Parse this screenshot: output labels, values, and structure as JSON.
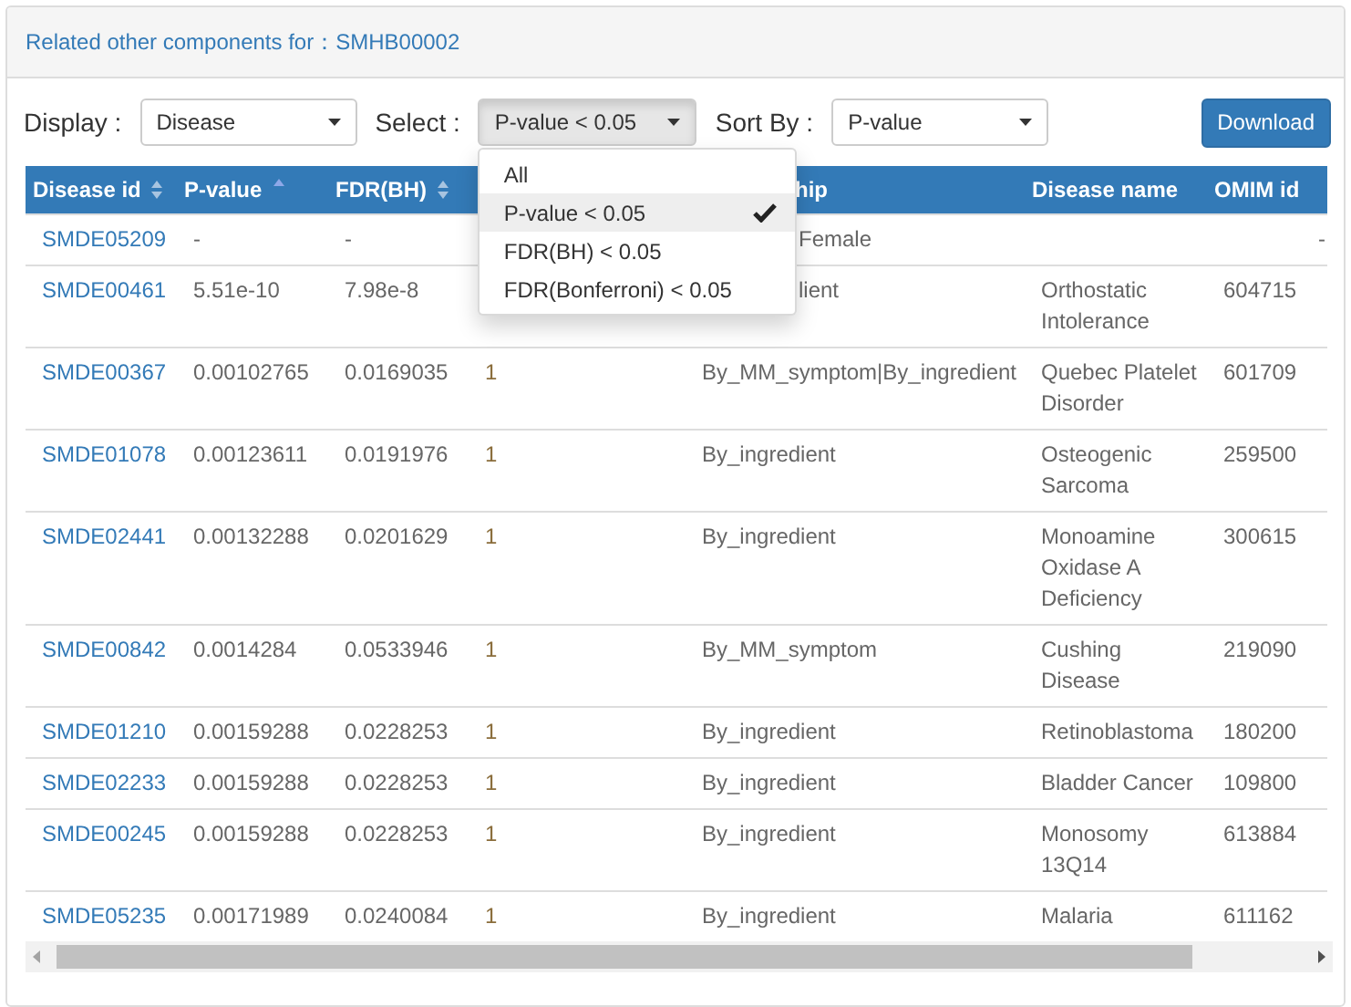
{
  "panel_heading": {
    "label": "Related other components for：",
    "value": "SMHB00002"
  },
  "filters": [
    {
      "kind": "select",
      "label": "Display :",
      "value": "Disease",
      "expanded": false
    },
    {
      "kind": "select",
      "label": "Select :",
      "value": "P-value < 0.05",
      "expanded": true,
      "options": [
        {
          "label": "All",
          "selected": false
        },
        {
          "label": "P-value < 0.05",
          "selected": true
        },
        {
          "label": "FDR(BH) < 0.05",
          "selected": false
        },
        {
          "label": "FDR(Bonferroni) < 0.05",
          "selected": false
        }
      ]
    },
    {
      "kind": "select",
      "label": "Sort By :",
      "value": "P-value",
      "expanded": false
    }
  ],
  "download_button": "Download",
  "table": {
    "columns": [
      {
        "label": "Disease id",
        "sortable": true,
        "sorted": false
      },
      {
        "label": "P-value",
        "sortable": true,
        "sorted": true
      },
      {
        "label": "FDR(BH)",
        "sortable": true,
        "sorted": false
      },
      {},
      {
        "label": "hip"
      },
      {
        "label": "Disease name"
      },
      {
        "label": "OMIM id"
      },
      {}
    ],
    "rows": [
      {
        "cells": [
          "SMDE05209",
          "-",
          "-",
          "",
          "Female",
          "",
          "",
          "-"
        ]
      },
      {
        "cells": [
          "SMDE00461",
          "5.51e-10",
          "7.98e-8",
          "",
          "lient",
          "Orthostatic Intolerance",
          "604715",
          ""
        ]
      },
      {
        "cells": [
          "SMDE00367",
          "0.00102765",
          "0.0169035",
          "1",
          "By_MM_symptom|By_ingredient",
          "Quebec Platelet Disorder",
          "601709",
          ""
        ]
      },
      {
        "cells": [
          "SMDE01078",
          "0.00123611",
          "0.0191976",
          "1",
          "By_ingredient",
          "Osteogenic Sarcoma",
          "259500",
          ""
        ]
      },
      {
        "cells": [
          "SMDE02441",
          "0.00132288",
          "0.0201629",
          "1",
          "By_ingredient",
          "Monoamine Oxidase A Deficiency",
          "300615",
          ""
        ]
      },
      {
        "cells": [
          "SMDE00842",
          "0.0014284",
          "0.0533946",
          "1",
          "By_MM_symptom",
          "Cushing Disease",
          "219090",
          ""
        ]
      },
      {
        "cells": [
          "SMDE01210",
          "0.00159288",
          "0.0228253",
          "1",
          "By_ingredient",
          "Retinoblastoma",
          "180200",
          ""
        ]
      },
      {
        "cells": [
          "SMDE02233",
          "0.00159288",
          "0.0228253",
          "1",
          "By_ingredient",
          "Bladder Cancer",
          "109800",
          ""
        ]
      },
      {
        "cells": [
          "SMDE00245",
          "0.00159288",
          "0.0228253",
          "1",
          "By_ingredient",
          "Monosomy 13Q14",
          "613884",
          ""
        ]
      },
      {
        "cells": [
          "SMDE05235",
          "0.00171989",
          "0.0240084",
          "1",
          "By_ingredient",
          "Malaria",
          "611162",
          ""
        ]
      }
    ]
  }
}
